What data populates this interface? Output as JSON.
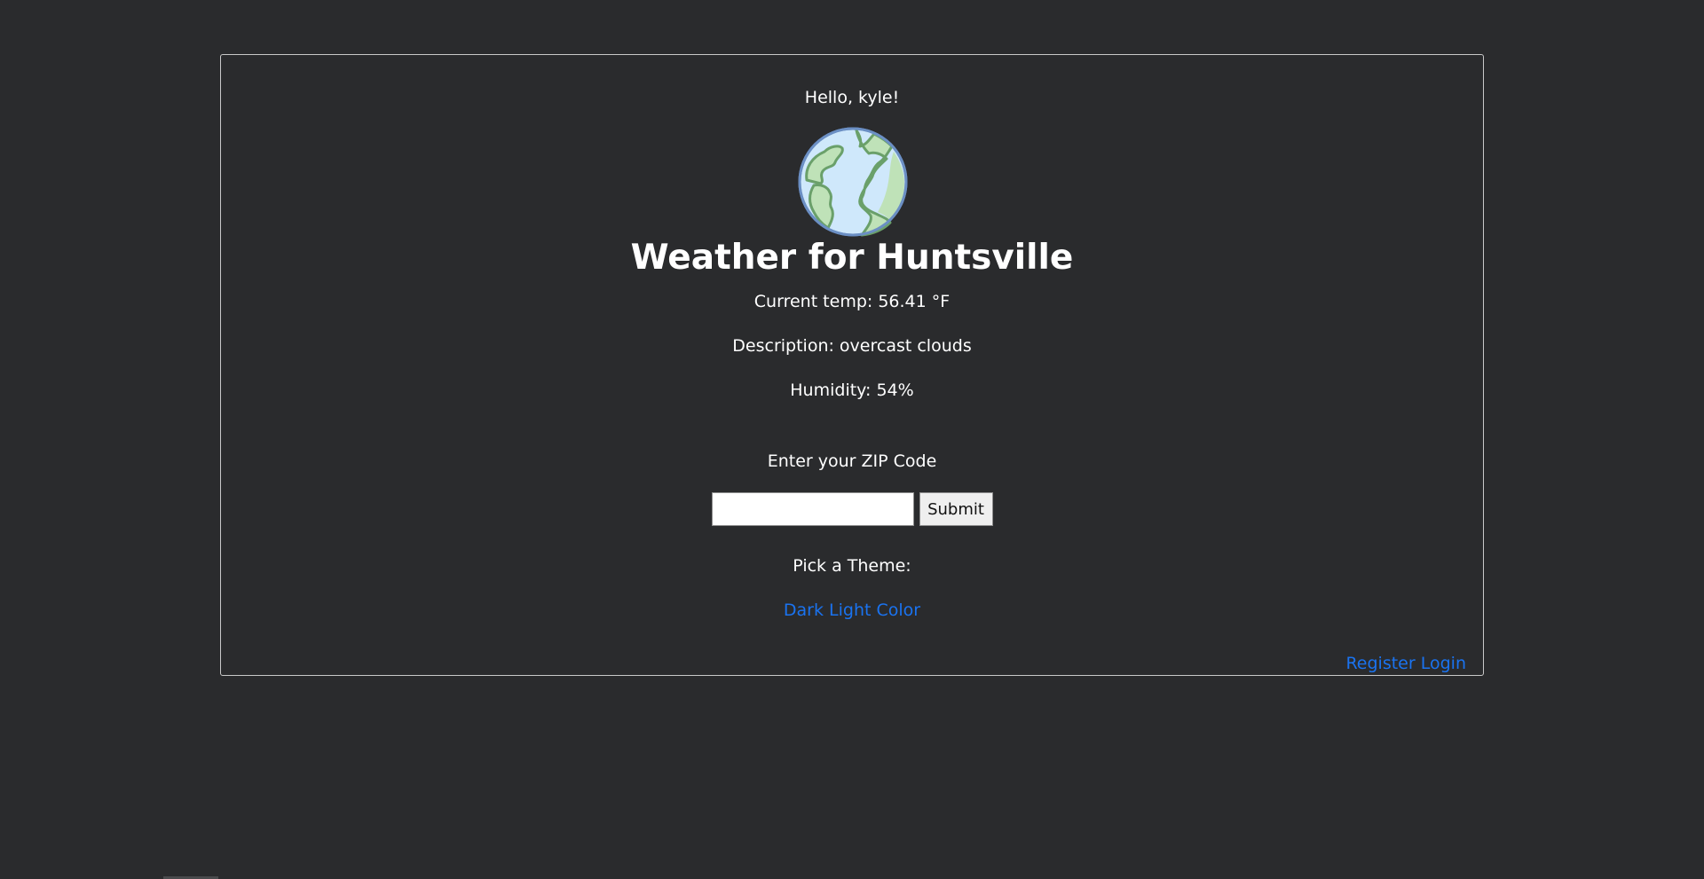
{
  "greeting": "Hello, kyle!",
  "title": "Weather for Huntsville",
  "weather": {
    "temp": "Current temp: 56.41 °F",
    "description": "Description: overcast clouds",
    "humidity": "Humidity: 54%"
  },
  "zip_form": {
    "label": "Enter your ZIP Code",
    "input_value": "",
    "submit_label": "Submit"
  },
  "theme": {
    "label": "Pick a Theme:",
    "options": [
      "Dark",
      "Light",
      "Color"
    ]
  },
  "auth": {
    "register": "Register",
    "login": "Login"
  },
  "colors": {
    "background": "#2a2b2d",
    "link": "#1a73f0",
    "globe_water": "#cfe8fb",
    "globe_land": "#bfe2b8",
    "globe_outline": "#6b8fc4"
  },
  "icons": {
    "globe": "globe-icon"
  }
}
